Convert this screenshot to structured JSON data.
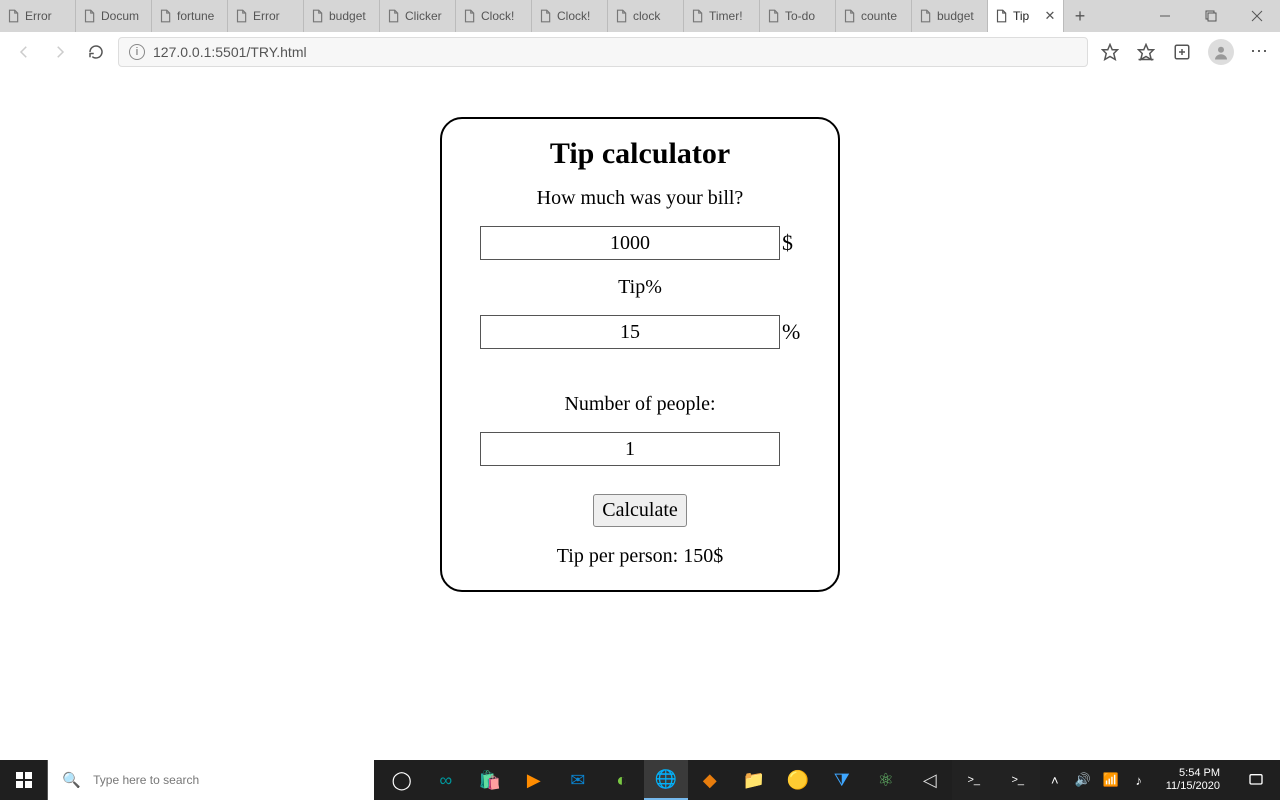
{
  "browser": {
    "tabs": [
      {
        "label": "Error"
      },
      {
        "label": "Docum"
      },
      {
        "label": "fortune"
      },
      {
        "label": "Error"
      },
      {
        "label": "budget"
      },
      {
        "label": "Clicker"
      },
      {
        "label": "Clock!"
      },
      {
        "label": "Clock!"
      },
      {
        "label": "clock"
      },
      {
        "label": "Timer!"
      },
      {
        "label": "To-do"
      },
      {
        "label": "counte"
      },
      {
        "label": "budget"
      },
      {
        "label": "Tip",
        "active": true
      }
    ],
    "url": "127.0.0.1:5501/TRY.html"
  },
  "calc": {
    "title": "Tip calculator",
    "bill_label": "How much was your bill?",
    "bill_value": "1000",
    "bill_unit": "$",
    "tip_label": "Tip%",
    "tip_value": "15",
    "tip_unit": "%",
    "people_label": "Number of people:",
    "people_value": "1",
    "button": "Calculate",
    "result": "Tip per person: 150$"
  },
  "taskbar": {
    "search_placeholder": "Type here to search",
    "time": "5:54 PM",
    "date": "11/15/2020"
  }
}
